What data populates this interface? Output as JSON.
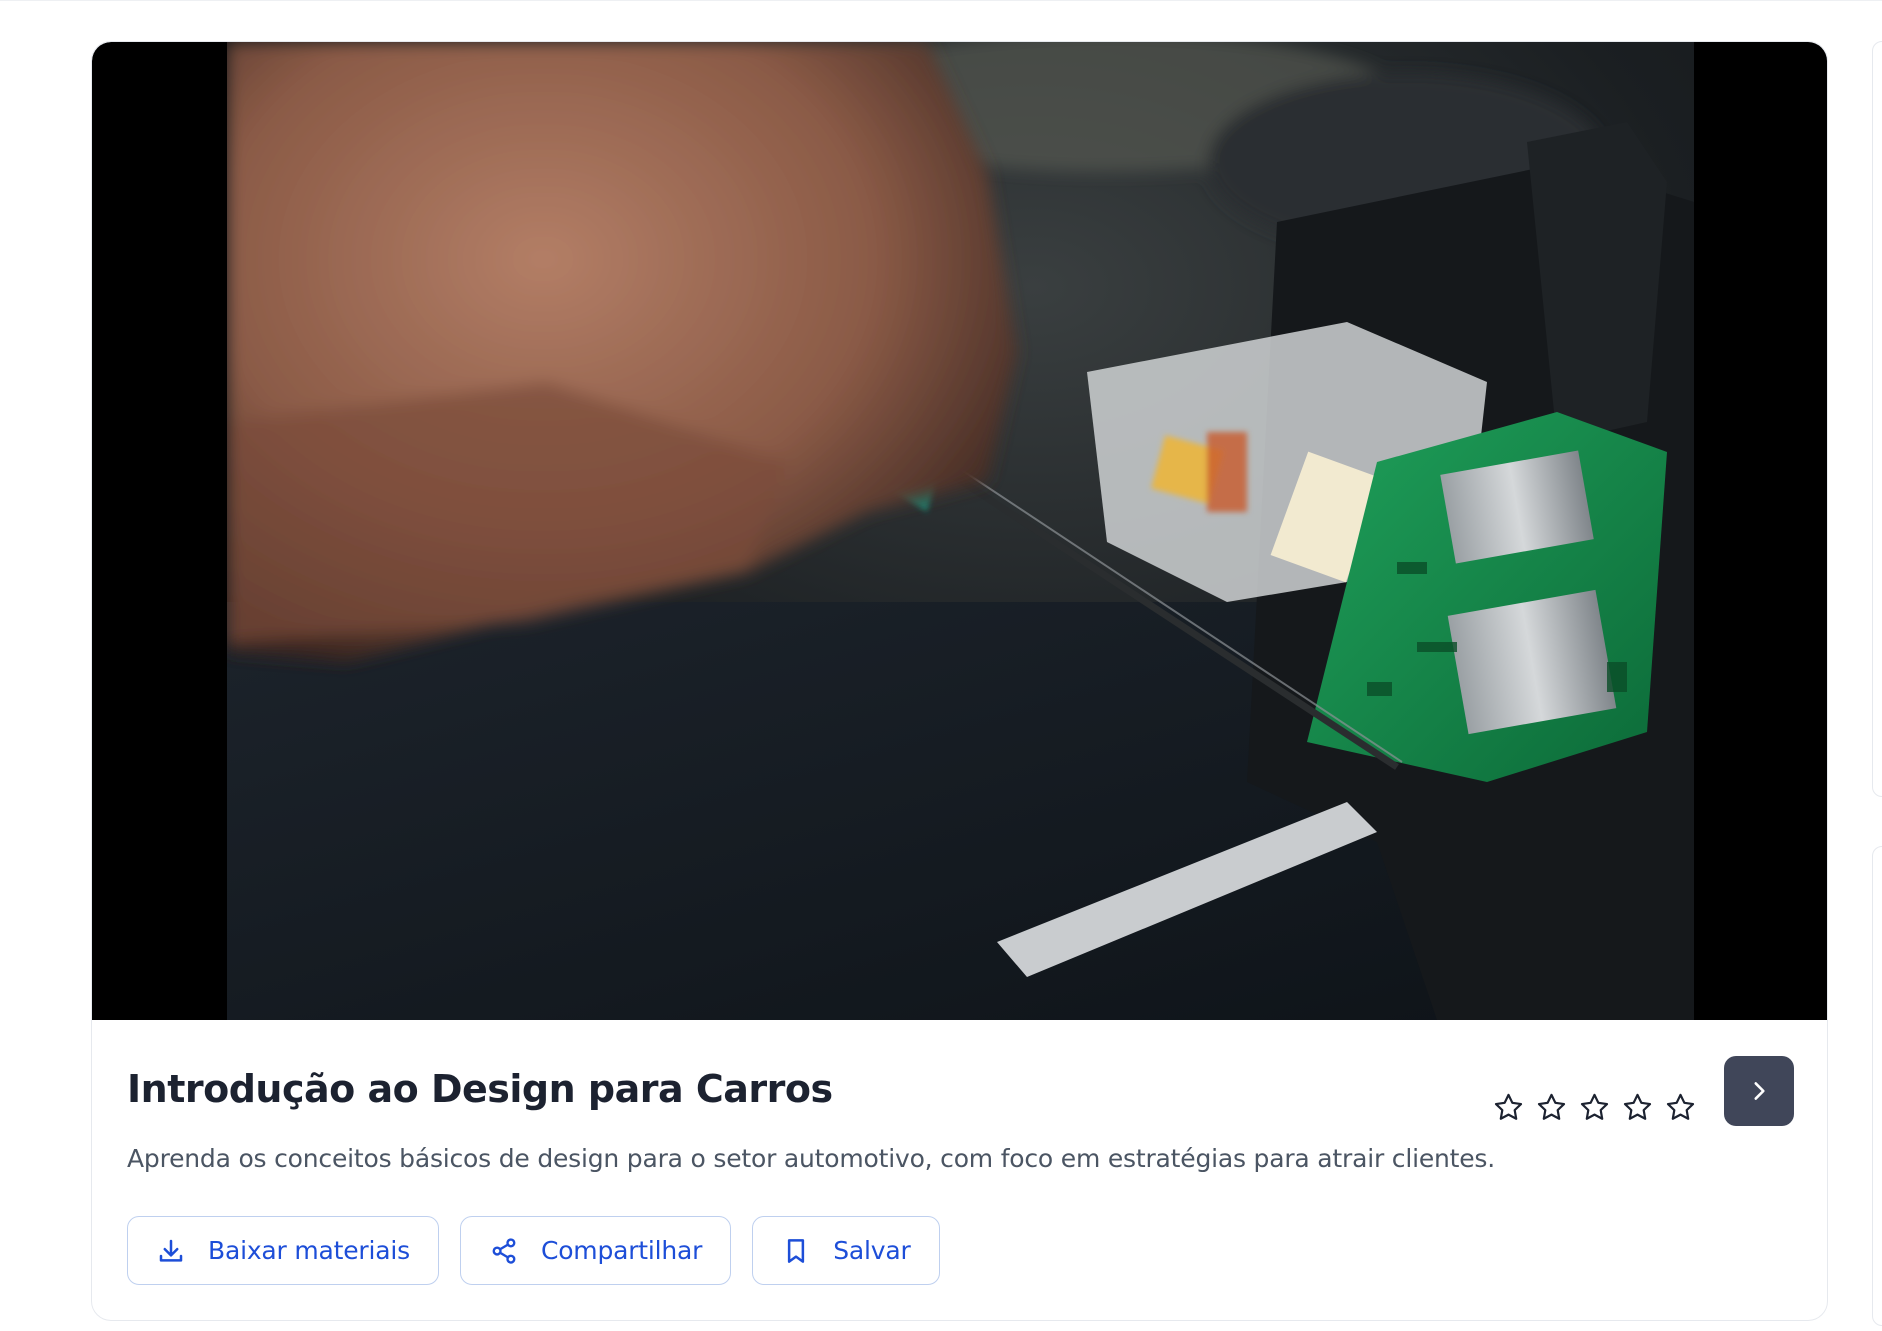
{
  "course": {
    "title": "Introdução ao Design para Carros",
    "description": "Aprenda os conceitos básicos de design para o setor automotivo, com foco em estratégias para atrair clientes.",
    "image_icon": "electronics-repair-photo",
    "rating": {
      "filled": 0,
      "total": 5
    },
    "next_icon": "chevron-right-icon"
  },
  "actions": {
    "download_label": "Baixar materiais",
    "download_icon": "download-icon",
    "share_label": "Compartilhar",
    "share_icon": "share-icon",
    "save_label": "Salvar",
    "save_icon": "bookmark-icon"
  },
  "colors": {
    "accent": "#1d4ed8",
    "title": "#1c2230",
    "next_button": "#404659",
    "button_border": "#bfd0ef"
  }
}
